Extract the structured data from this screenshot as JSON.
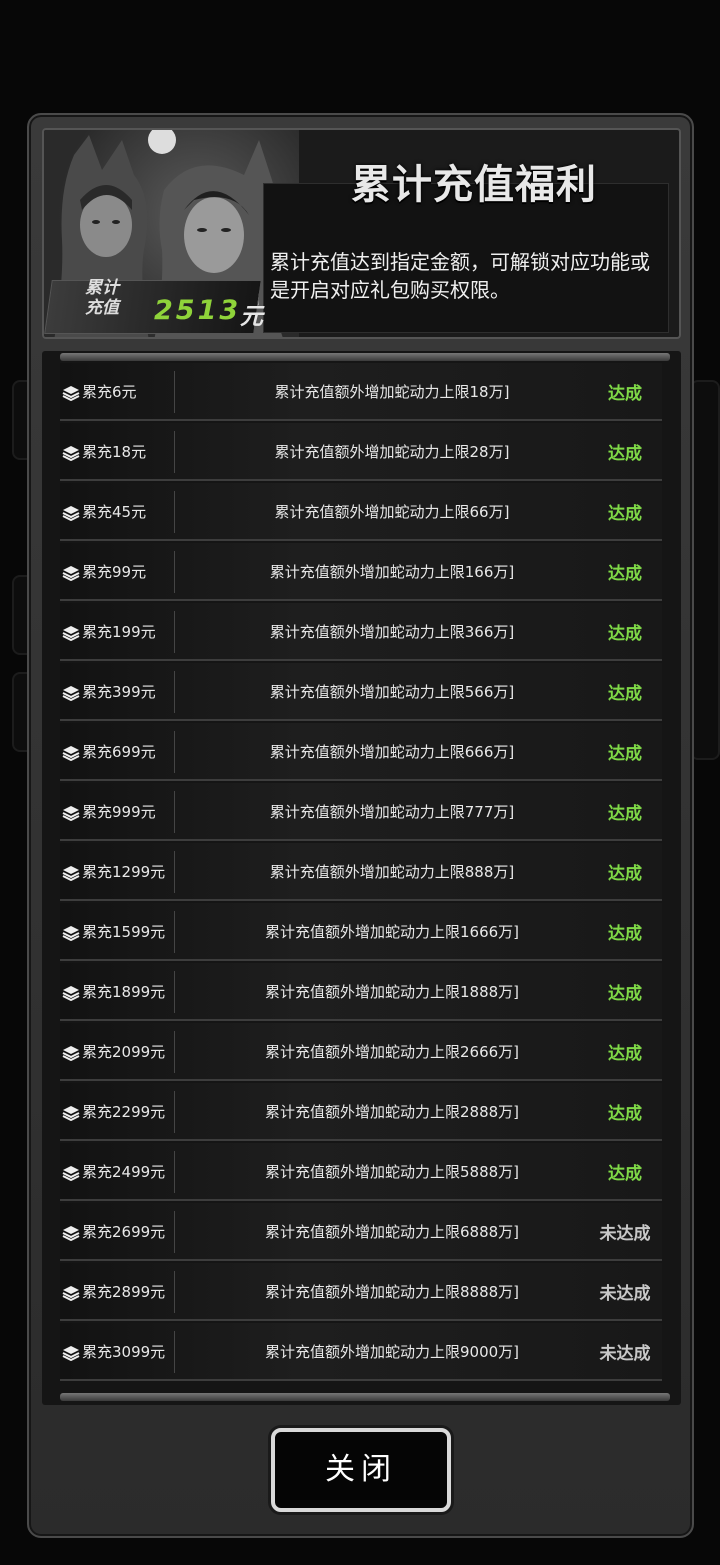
{
  "header": {
    "title": "累计充值福利",
    "description": "累计充值达到指定金额，可解锁对应功能或是开启对应礼包购买权限。",
    "total_label_line1": "累计",
    "total_label_line2": "充值",
    "total_value": "2513",
    "total_unit": "元"
  },
  "rows": [
    {
      "tier": "累充6元",
      "reward": "累计充值额外增加蛇动力上限18万]",
      "status": "达成",
      "done": true
    },
    {
      "tier": "累充18元",
      "reward": "累计充值额外增加蛇动力上限28万]",
      "status": "达成",
      "done": true
    },
    {
      "tier": "累充45元",
      "reward": "累计充值额外增加蛇动力上限66万]",
      "status": "达成",
      "done": true
    },
    {
      "tier": "累充99元",
      "reward": "累计充值额外增加蛇动力上限166万]",
      "status": "达成",
      "done": true
    },
    {
      "tier": "累充199元",
      "reward": "累计充值额外增加蛇动力上限366万]",
      "status": "达成",
      "done": true
    },
    {
      "tier": "累充399元",
      "reward": "累计充值额外增加蛇动力上限566万]",
      "status": "达成",
      "done": true
    },
    {
      "tier": "累充699元",
      "reward": "累计充值额外增加蛇动力上限666万]",
      "status": "达成",
      "done": true
    },
    {
      "tier": "累充999元",
      "reward": "累计充值额外增加蛇动力上限777万]",
      "status": "达成",
      "done": true
    },
    {
      "tier": "累充1299元",
      "reward": "累计充值额外增加蛇动力上限888万]",
      "status": "达成",
      "done": true
    },
    {
      "tier": "累充1599元",
      "reward": "累计充值额外增加蛇动力上限1666万]",
      "status": "达成",
      "done": true
    },
    {
      "tier": "累充1899元",
      "reward": "累计充值额外增加蛇动力上限1888万]",
      "status": "达成",
      "done": true
    },
    {
      "tier": "累充2099元",
      "reward": "累计充值额外增加蛇动力上限2666万]",
      "status": "达成",
      "done": true
    },
    {
      "tier": "累充2299元",
      "reward": "累计充值额外增加蛇动力上限2888万]",
      "status": "达成",
      "done": true
    },
    {
      "tier": "累充2499元",
      "reward": "累计充值额外增加蛇动力上限5888万]",
      "status": "达成",
      "done": true
    },
    {
      "tier": "累充2699元",
      "reward": "累计充值额外增加蛇动力上限6888万]",
      "status": "未达成",
      "done": false
    },
    {
      "tier": "累充2899元",
      "reward": "累计充值额外增加蛇动力上限8888万]",
      "status": "未达成",
      "done": false
    },
    {
      "tier": "累充3099元",
      "reward": "累计充值额外增加蛇动力上限9000万]",
      "status": "未达成",
      "done": false
    }
  ],
  "close_button": {
    "label": "关闭"
  },
  "colors": {
    "done": "#7fd947",
    "todo": "#c8c8c8",
    "total": "#8fd33a"
  }
}
